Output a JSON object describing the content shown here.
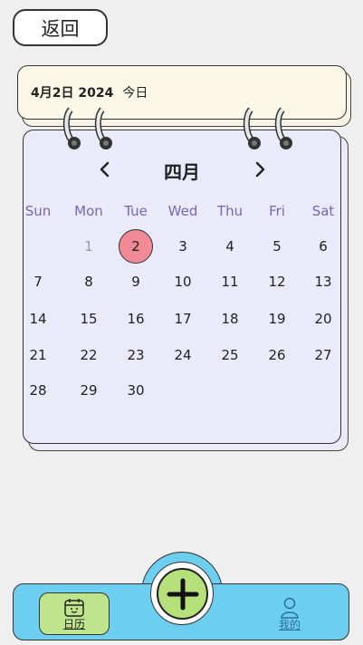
{
  "header": {
    "back_label": "返回"
  },
  "date_card": {
    "date": "4月2日 2024",
    "today_label": "今日"
  },
  "calendar": {
    "month": "四月",
    "weekdays": [
      "Sun",
      "Mon",
      "Tue",
      "Wed",
      "Thu",
      "Fri",
      "Sat"
    ],
    "days": [
      [
        "",
        "1",
        "2",
        "3",
        "4",
        "5",
        "6"
      ],
      [
        "7",
        "8",
        "9",
        "10",
        "11",
        "12",
        "13"
      ],
      [
        "14",
        "15",
        "16",
        "17",
        "18",
        "19",
        "20"
      ],
      [
        "21",
        "22",
        "23",
        "24",
        "25",
        "26",
        "27"
      ],
      [
        "28",
        "29",
        "30",
        "",
        "",
        "",
        ""
      ]
    ],
    "muted_day": "1",
    "selected_day": "2"
  },
  "tabbar": {
    "calendar_label": "日历",
    "profile_label": "我的",
    "add_icon": "plus-icon"
  },
  "colors": {
    "background": "#efefef",
    "calendar_bg": "#ebeafb",
    "weekday_text": "#7667b4",
    "selected_day": "#f08a94",
    "tabbar": "#6dcff0",
    "fab": "#b6e07a",
    "date_card": "#fbf8e8"
  }
}
